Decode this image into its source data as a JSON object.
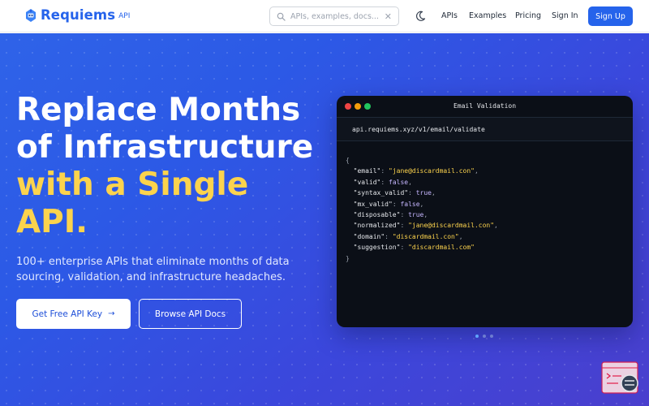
{
  "nav": {
    "brand_name": "Requiems",
    "brand_tag": "API",
    "search_placeholder": "APIs, examples, docs...",
    "clear_glyph": "✕",
    "links": [
      "APIs",
      "Examples",
      "Pricing",
      "Sign In"
    ],
    "signup": "Sign Up"
  },
  "hero": {
    "headline_line1": "Replace Months",
    "headline_line2": "of Infrastructure",
    "headline_accent": "with a Single",
    "headline_line4": "API.",
    "subtext": "100+ enterprise APIs that eliminate months of data sourcing, validation, and infrastructure headaches.",
    "primary_cta": "Get Free API Key",
    "primary_cta_arrow": "→",
    "secondary_cta": "Browse API Docs"
  },
  "code_window": {
    "title": "Email Validation",
    "url": "api.requiems.xyz/v1/email/validate",
    "open_brace": "{",
    "close_brace": "}",
    "fields": [
      {
        "key": "\"email\"",
        "value": "\"jane@discardmail.con\"",
        "kind": "str",
        "comma": ","
      },
      {
        "key": "\"valid\"",
        "value": "false",
        "kind": "bool",
        "comma": ","
      },
      {
        "key": "\"syntax_valid\"",
        "value": "true",
        "kind": "bool",
        "comma": ","
      },
      {
        "key": "\"mx_valid\"",
        "value": "false",
        "kind": "bool",
        "comma": ","
      },
      {
        "key": "\"disposable\"",
        "value": "true",
        "kind": "bool",
        "comma": ","
      },
      {
        "key": "\"normalized\"",
        "value": "\"jane@discardmail.con\"",
        "kind": "str",
        "comma": ","
      },
      {
        "key": "\"domain\"",
        "value": "\"discardmail.con\"",
        "kind": "str",
        "comma": ","
      },
      {
        "key": "\"suggestion\"",
        "value": "\"discardmail.com\"",
        "kind": "str",
        "comma": ""
      }
    ]
  },
  "carousel": {
    "count": 3,
    "active_index": 0
  },
  "colors": {
    "brand": "#2563eb",
    "accent_yellow": "#fcd34d",
    "hero_start": "#2f63e8",
    "hero_end": "#4a3fcd",
    "code_bg": "#0b0f17"
  },
  "icons": [
    "robot-logo-icon",
    "search-icon",
    "close-icon",
    "moon-icon",
    "arrow-right-icon",
    "terminal-widget-icon"
  ]
}
